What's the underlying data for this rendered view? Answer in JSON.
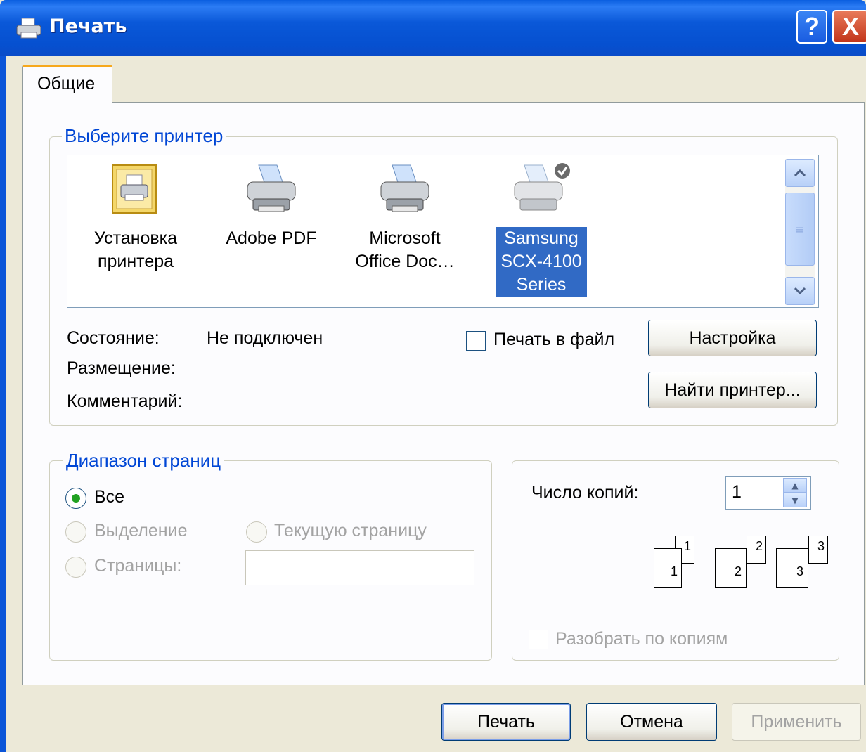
{
  "window": {
    "title": "Печать"
  },
  "tabs": [
    {
      "label": "Общие"
    }
  ],
  "printer_group": {
    "title": "Выберите принтер",
    "printers": [
      {
        "line1": "Установка",
        "line2": "принтера",
        "line3": ""
      },
      {
        "line1": "Adobe PDF",
        "line2": "",
        "line3": ""
      },
      {
        "line1": "Microsoft",
        "line2": "Office Doc…",
        "line3": ""
      },
      {
        "line1": "Samsung",
        "line2": "SCX-4100",
        "line3": "Series"
      }
    ],
    "status_label": "Состояние:",
    "status_value": "Не подключен",
    "location_label": "Размещение:",
    "comment_label": "Комментарий:",
    "print_to_file": "Печать в файл",
    "settings_button": "Настройка",
    "find_printer_button": "Найти принтер..."
  },
  "range_group": {
    "title": "Диапазон страниц",
    "all": "Все",
    "selection": "Выделение",
    "current_page": "Текущую страницу",
    "pages": "Страницы:",
    "pages_value": ""
  },
  "copies": {
    "label": "Число копий:",
    "value": "1",
    "collate": "Разобрать по копиям",
    "page_numbers": [
      "1",
      "1",
      "2",
      "2",
      "3",
      "3"
    ]
  },
  "buttons": {
    "print": "Печать",
    "cancel": "Отмена",
    "apply": "Применить"
  },
  "help_glyph": "?",
  "close_glyph": "X"
}
